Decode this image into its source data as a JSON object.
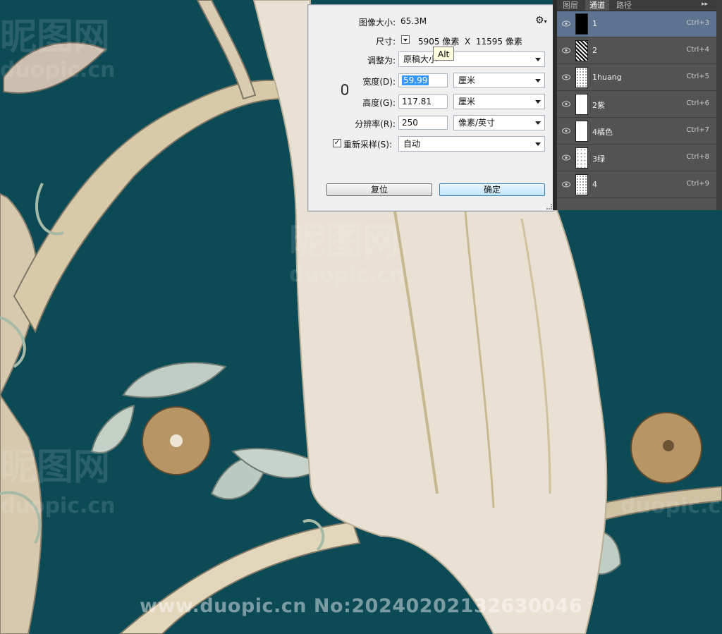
{
  "dialog": {
    "image_size_label": "图像大小:",
    "image_size_value": "65.3M",
    "gear_icon": "gear-icon",
    "dimensions_label": "尺寸:",
    "dimensions_value": "5905 像素  X  11595 像素",
    "fit_to_label": "调整为:",
    "fit_to_value": "原稿大小",
    "width_label": "宽度(D):",
    "width_value": "59.99",
    "width_unit": "厘米",
    "height_label": "高度(G):",
    "height_value": "117.81",
    "height_unit": "厘米",
    "resolution_label": "分辨率(R):",
    "resolution_value": "250",
    "resolution_unit": "像素/英寸",
    "resample_label": "重新采样(S):",
    "resample_checked": true,
    "resample_value": "自动",
    "reset_button": "复位",
    "ok_button": "确定",
    "tooltip": "Alt"
  },
  "panel": {
    "tabs": [
      "图层",
      "通道",
      "路径"
    ],
    "active_tab": "通道",
    "channels": [
      {
        "name": "1",
        "shortcut": "Ctrl+3",
        "active": true,
        "thumb": "black"
      },
      {
        "name": "2",
        "shortcut": "Ctrl+4",
        "active": false,
        "thumb": "noise"
      },
      {
        "name": "1huang",
        "shortcut": "Ctrl+5",
        "active": false,
        "thumb": "speckle"
      },
      {
        "name": "2紫",
        "shortcut": "Ctrl+6",
        "active": false,
        "thumb": "white"
      },
      {
        "name": "4橘色",
        "shortcut": "Ctrl+7",
        "active": false,
        "thumb": "white"
      },
      {
        "name": "3绿",
        "shortcut": "Ctrl+8",
        "active": false,
        "thumb": "speckle"
      },
      {
        "name": "4",
        "shortcut": "Ctrl+9",
        "active": false,
        "thumb": "speckle"
      }
    ]
  },
  "watermark": {
    "bottom_text": "www.duopic.cn No:20240202132630046",
    "site_text": "duopic.cn",
    "brand_text": "昵图网"
  },
  "colors": {
    "background": "#0c4a55",
    "branch": "#d9ccb0",
    "flower": "#b79565",
    "leaf": "#bfcdc4"
  }
}
